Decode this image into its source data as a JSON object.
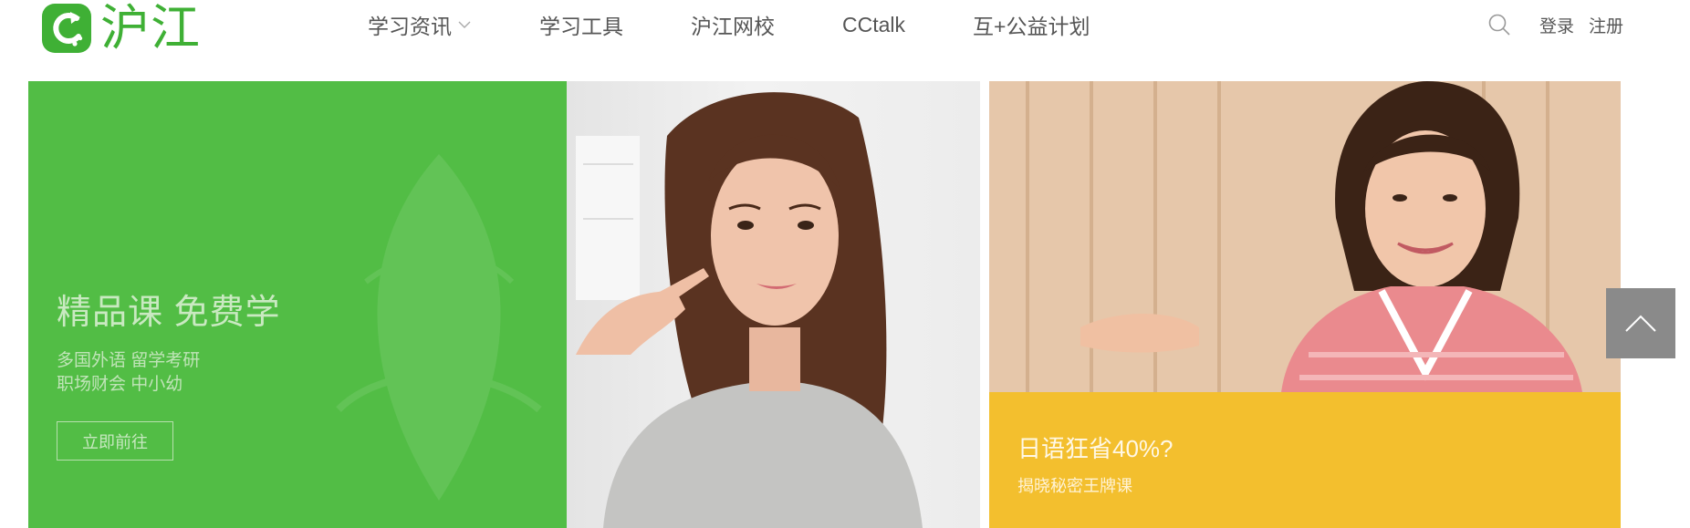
{
  "brand": {
    "name": "沪江",
    "color": "#3fb035"
  },
  "nav": {
    "items": [
      {
        "label": "学习资讯",
        "icon": "chevron-down-icon"
      },
      {
        "label": "学习工具"
      },
      {
        "label": "沪江网校"
      },
      {
        "label": "CCtalk"
      },
      {
        "label": "互+公益计划"
      }
    ]
  },
  "header": {
    "search_icon": "search-icon",
    "login": "登录",
    "register": "注册"
  },
  "banner_left": {
    "bg_color": "#52bd45",
    "title": "精品课 免费学",
    "line1": "多国外语 留学考研",
    "line2": "职场财会 中小幼",
    "button": "立即前往"
  },
  "banner_right": {
    "bg_color": "#f3bf2e",
    "title": "日语狂省40%?",
    "subtitle": "揭晓秘密王牌课"
  },
  "back_to_top_icon": "chevron-up-icon"
}
